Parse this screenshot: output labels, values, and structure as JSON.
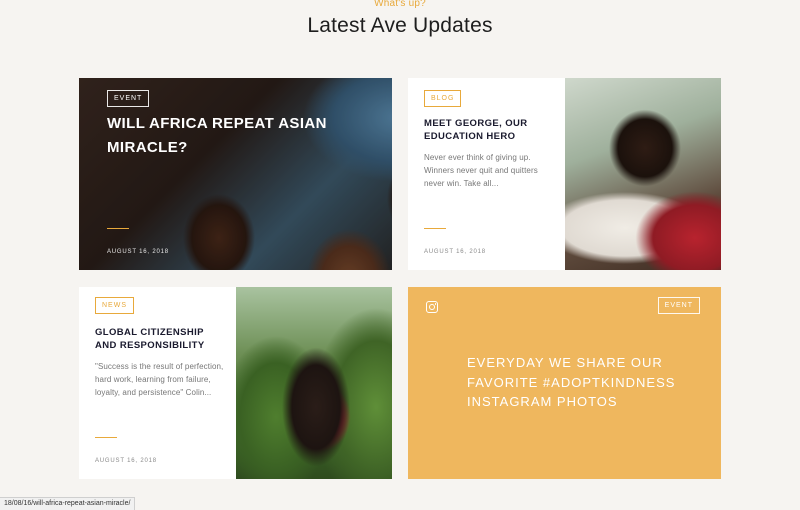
{
  "header": {
    "eyebrow": "What's up?",
    "title": "Latest Ave Updates"
  },
  "cards": [
    {
      "tag": "EVENT",
      "title": "WILL AFRICA REPEAT ASIAN MIRACLE?",
      "date": "AUGUST 16, 2018"
    },
    {
      "tag": "BLOG",
      "title": "MEET GEORGE, OUR EDUCATION HERO",
      "excerpt": "Never ever think of giving up. Winners never quit and quitters never win. Take all...",
      "date": "AUGUST 16, 2018"
    },
    {
      "tag": "NEWS",
      "title": "GLOBAL CITIZENSHIP AND RESPONSIBILITY",
      "excerpt": "\"Success is the result of perfection, hard work, learning from failure, loyalty, and persistence\" Colin...",
      "date": "AUGUST 16, 2018"
    },
    {
      "tag": "EVENT",
      "text": "EVERYDAY WE SHARE OUR FAVORITE #ADOPTKINDNESS INSTAGRAM PHOTOS",
      "icon": "instagram-icon"
    }
  ],
  "status_bar": {
    "url": "18/08/16/will-africa-repeat-asian-miracle/"
  },
  "colors": {
    "accent": "#e8a93b",
    "instagram_card": "#efb75e",
    "background": "#f6f4f1"
  }
}
